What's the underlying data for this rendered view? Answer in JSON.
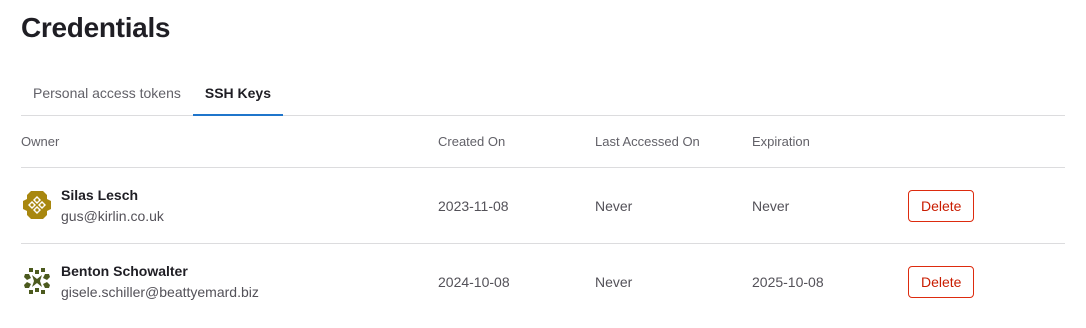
{
  "page": {
    "title": "Credentials"
  },
  "tabs": [
    {
      "label": "Personal access tokens",
      "active": false
    },
    {
      "label": "SSH Keys",
      "active": true
    }
  ],
  "table": {
    "headers": {
      "owner": "Owner",
      "created": "Created On",
      "accessed": "Last Accessed On",
      "expiration": "Expiration"
    },
    "rows": [
      {
        "name": "Silas Lesch",
        "email": "gus@kirlin.co.uk",
        "created": "2023-11-08",
        "accessed": "Never",
        "expiration": "Never",
        "action": "Delete",
        "avatar_color": "#a8870f"
      },
      {
        "name": "Benton Schowalter",
        "email": "gisele.schiller@beattyemard.biz",
        "created": "2024-10-08",
        "accessed": "Never",
        "expiration": "2025-10-08",
        "action": "Delete",
        "avatar_color": "#4c5a1e"
      }
    ]
  },
  "colors": {
    "accent": "#1f75cb",
    "danger": "#dd2b0e",
    "border": "#dcdcde"
  },
  "icons": {
    "avatar_style": "identicon"
  }
}
